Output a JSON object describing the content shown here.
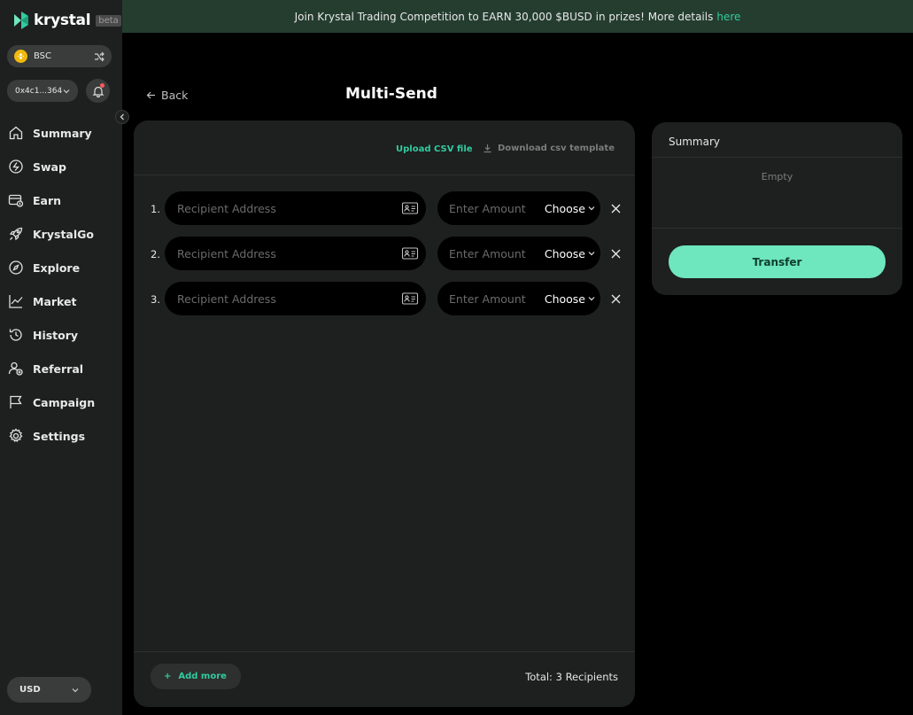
{
  "brand": {
    "name": "krystal",
    "badge": "beta",
    "accent": "#31cb9e"
  },
  "sidebar": {
    "chain": {
      "label": "BSC"
    },
    "wallet": {
      "address": "0x4c1...364"
    },
    "items": [
      {
        "label": "Summary",
        "icon": "home-icon"
      },
      {
        "label": "Swap",
        "icon": "swap-icon"
      },
      {
        "label": "Earn",
        "icon": "earn-icon"
      },
      {
        "label": "KrystalGo",
        "icon": "rocket-icon"
      },
      {
        "label": "Explore",
        "icon": "compass-icon"
      },
      {
        "label": "Market",
        "icon": "chart-icon"
      },
      {
        "label": "History",
        "icon": "history-icon"
      },
      {
        "label": "Referral",
        "icon": "referral-icon"
      },
      {
        "label": "Campaign",
        "icon": "flag-icon"
      },
      {
        "label": "Settings",
        "icon": "gear-icon"
      }
    ],
    "currency": "USD"
  },
  "banner": {
    "text": "Join Krystal Trading Competition to EARN 30,000 $BUSD in prizes! More details",
    "link": "here"
  },
  "header": {
    "back_label": "Back",
    "title": "Multi-Send"
  },
  "multisend": {
    "upload_label": "Upload CSV file",
    "download_label": "Download csv template",
    "rows": [
      {
        "num": "1.",
        "address_placeholder": "Recipient Address",
        "amount_placeholder": "Enter Amount",
        "token_label": "Choose"
      },
      {
        "num": "2.",
        "address_placeholder": "Recipient Address",
        "amount_placeholder": "Enter Amount",
        "token_label": "Choose"
      },
      {
        "num": "3.",
        "address_placeholder": "Recipient Address",
        "amount_placeholder": "Enter Amount",
        "token_label": "Choose"
      }
    ],
    "add_more_label": "Add more",
    "total_label": "Total: 3 Recipients"
  },
  "summary": {
    "title": "Summary",
    "empty_label": "Empty",
    "transfer_label": "Transfer"
  }
}
